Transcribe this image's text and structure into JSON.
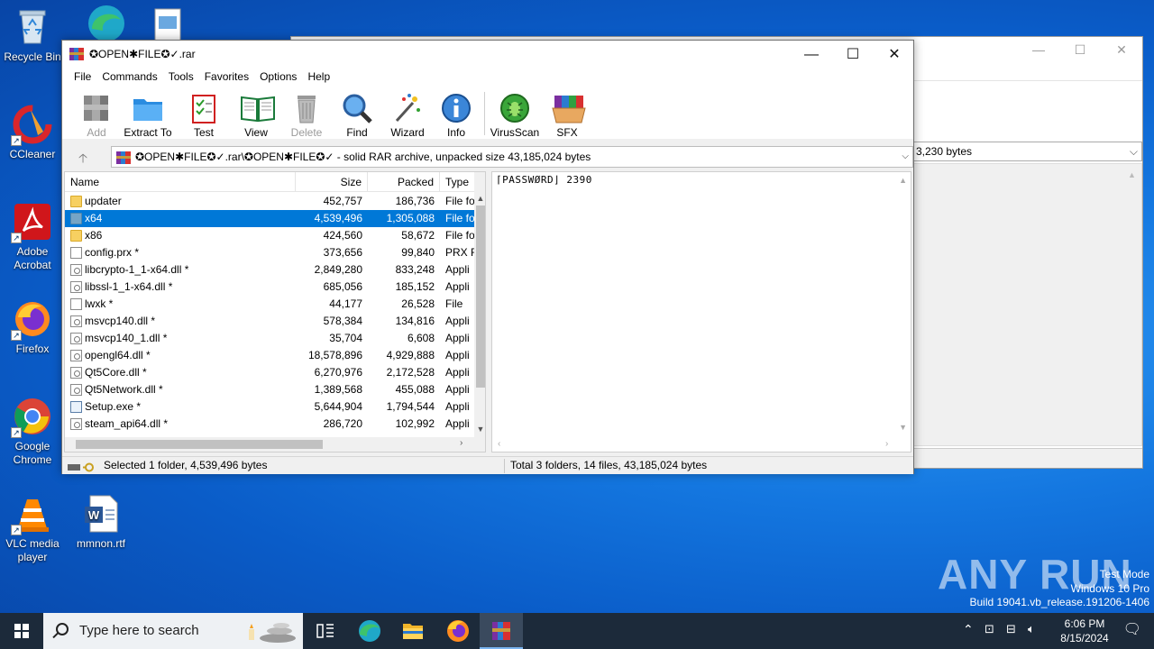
{
  "desktop_icons": [
    {
      "label": "Recycle Bin"
    },
    {
      "label": "CCleaner"
    },
    {
      "label": "Adobe Acrobat"
    },
    {
      "label": "Firefox"
    },
    {
      "label": "Google Chrome"
    },
    {
      "label": "VLC media player"
    },
    {
      "label": "mmnon.rtf"
    }
  ],
  "background_window": {
    "address_value": "3,230 bytes"
  },
  "winrar": {
    "title": "✪OPEN✱FILE✪✓.rar",
    "menu": [
      "File",
      "Commands",
      "Tools",
      "Favorites",
      "Options",
      "Help"
    ],
    "toolbar": {
      "add": "Add",
      "extract_to": "Extract To",
      "test": "Test",
      "view": "View",
      "delete": "Delete",
      "find": "Find",
      "wizard": "Wizard",
      "info": "Info",
      "virusscan": "VirusScan",
      "sfx": "SFX"
    },
    "address": "✪OPEN✱FILE✪✓.rar\\✪OPEN✱FILE✪✓ - solid RAR archive, unpacked size 43,185,024 bytes",
    "columns": {
      "name": "Name",
      "size": "Size",
      "packed": "Packed",
      "type": "Type"
    },
    "files": [
      {
        "name": "updater",
        "size": "452,757",
        "packed": "186,736",
        "type": "File fo",
        "kind": "folder"
      },
      {
        "name": "x64",
        "size": "4,539,496",
        "packed": "1,305,088",
        "type": "File fo",
        "kind": "folder",
        "selected": true
      },
      {
        "name": "x86",
        "size": "424,560",
        "packed": "58,672",
        "type": "File fo",
        "kind": "folder"
      },
      {
        "name": "config.prx *",
        "size": "373,656",
        "packed": "99,840",
        "type": "PRX F",
        "kind": "file"
      },
      {
        "name": "libcrypto-1_1-x64.dll *",
        "size": "2,849,280",
        "packed": "833,248",
        "type": "Appli",
        "kind": "dll"
      },
      {
        "name": "libssl-1_1-x64.dll *",
        "size": "685,056",
        "packed": "185,152",
        "type": "Appli",
        "kind": "dll"
      },
      {
        "name": "lwxk *",
        "size": "44,177",
        "packed": "26,528",
        "type": "File",
        "kind": "file"
      },
      {
        "name": "msvcp140.dll *",
        "size": "578,384",
        "packed": "134,816",
        "type": "Appli",
        "kind": "dll"
      },
      {
        "name": "msvcp140_1.dll *",
        "size": "35,704",
        "packed": "6,608",
        "type": "Appli",
        "kind": "dll"
      },
      {
        "name": "opengl64.dll *",
        "size": "18,578,896",
        "packed": "4,929,888",
        "type": "Appli",
        "kind": "dll"
      },
      {
        "name": "Qt5Core.dll *",
        "size": "6,270,976",
        "packed": "2,172,528",
        "type": "Appli",
        "kind": "dll"
      },
      {
        "name": "Qt5Network.dll *",
        "size": "1,389,568",
        "packed": "455,088",
        "type": "Appli",
        "kind": "dll"
      },
      {
        "name": "Setup.exe *",
        "size": "5,644,904",
        "packed": "1,794,544",
        "type": "Appli",
        "kind": "exe"
      },
      {
        "name": "steam_api64.dll *",
        "size": "286,720",
        "packed": "102,992",
        "type": "Appli",
        "kind": "dll"
      }
    ],
    "comment": "⌈PASSWØRD⌋ 2390",
    "status_left": "Selected 1 folder, 4,539,496 bytes",
    "status_right": "Total 3 folders, 14 files, 43,185,024 bytes"
  },
  "watermark": "ANY RUN",
  "windows_info": {
    "line1": "Test Mode",
    "line2": "Windows 10 Pro",
    "line3": "Build 19041.vb_release.191206-1406"
  },
  "taskbar": {
    "search_placeholder": "Type here to search",
    "time": "6:06 PM",
    "date": "8/15/2024"
  },
  "colors": {
    "selection": "#0078d7",
    "taskbar": "#1c2a3a",
    "desktop": "#0a5cc8"
  }
}
